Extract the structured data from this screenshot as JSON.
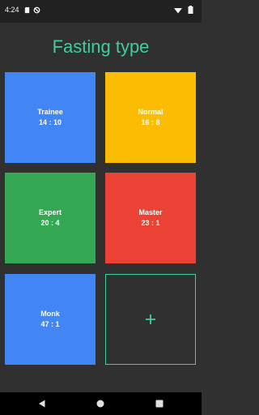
{
  "status_bar": {
    "time": "4:24",
    "icons": [
      "sd-card-icon",
      "do-not-disturb-icon",
      "wifi-icon",
      "battery-icon"
    ]
  },
  "page": {
    "title": "Fasting type"
  },
  "fasting_types": [
    {
      "name": "Trainee",
      "ratio": "14 : 10",
      "color": "#4285f4"
    },
    {
      "name": "Normal",
      "ratio": "16 : 8",
      "color": "#fbbc04"
    },
    {
      "name": "Expert",
      "ratio": "20 : 4",
      "color": "#34a853"
    },
    {
      "name": "Master",
      "ratio": "23 : 1",
      "color": "#ea4335"
    },
    {
      "name": "Monk",
      "ratio": "47 : 1",
      "color": "#4285f4"
    }
  ],
  "add_tile": {
    "icon": "plus-icon",
    "accent": "#3ecf9a"
  },
  "nav_bar": {
    "icons": [
      "back-icon",
      "home-icon",
      "recents-icon"
    ]
  },
  "colors": {
    "background": "#303030",
    "status_bar": "#212121",
    "accent": "#3ecf9a",
    "nav_bar": "#000000"
  }
}
